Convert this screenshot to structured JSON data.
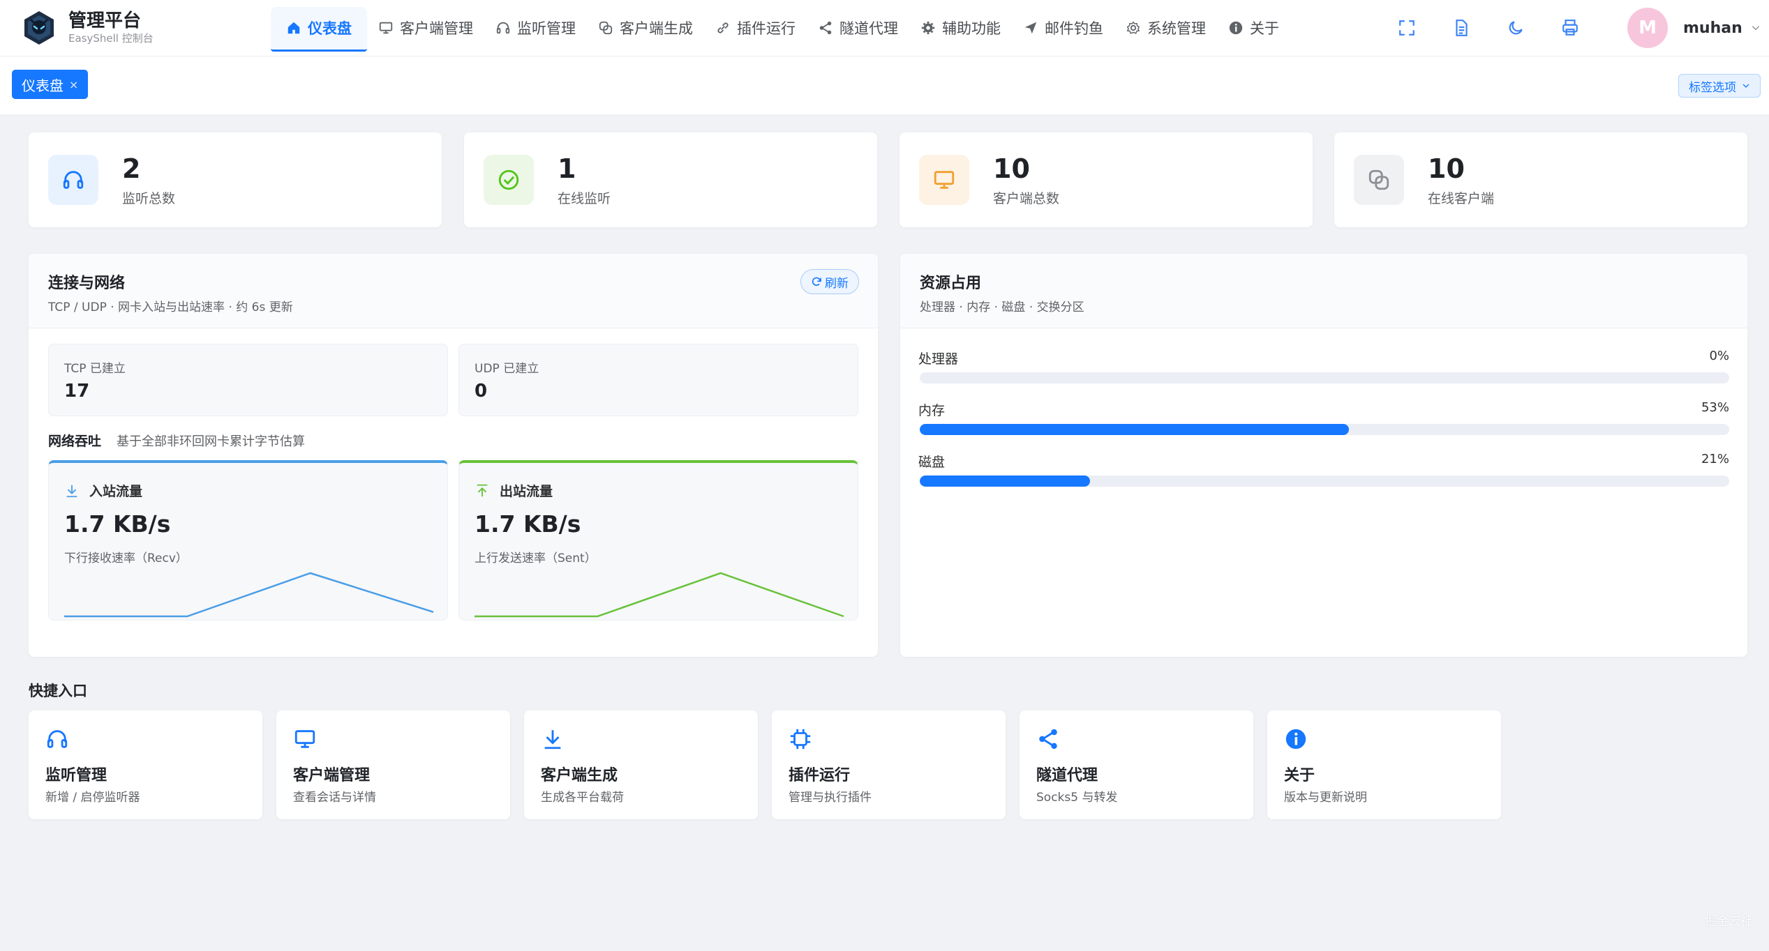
{
  "brand": {
    "title": "管理平台",
    "subtitle": "EasyShell 控制台"
  },
  "nav": [
    {
      "label": "仪表盘",
      "icon": "home-icon",
      "active": true
    },
    {
      "label": "客户端管理",
      "icon": "monitor-icon"
    },
    {
      "label": "监听管理",
      "icon": "headset-icon"
    },
    {
      "label": "客户端生成",
      "icon": "link-icon"
    },
    {
      "label": "插件运行",
      "icon": "chain-icon"
    },
    {
      "label": "隧道代理",
      "icon": "share-icon"
    },
    {
      "label": "辅助功能",
      "icon": "gear-icon"
    },
    {
      "label": "邮件钓鱼",
      "icon": "send-icon"
    },
    {
      "label": "系统管理",
      "icon": "settings-icon"
    },
    {
      "label": "关于",
      "icon": "info-icon"
    }
  ],
  "toolbar": {
    "icons": [
      "fullscreen-icon",
      "document-icon",
      "moon-icon",
      "printer-icon"
    ]
  },
  "user": {
    "initial": "M",
    "name": "muhan"
  },
  "tabs": {
    "active_label": "仪表盘",
    "close": "×",
    "options_label": "标签选项"
  },
  "stats": [
    {
      "value": "2",
      "label": "监听总数",
      "icon": "headset-icon",
      "color": "#1677ff",
      "bg": "#e8f2ff"
    },
    {
      "value": "1",
      "label": "在线监听",
      "icon": "check-circle-icon",
      "color": "#52c41a",
      "bg": "#ecf7e6"
    },
    {
      "value": "10",
      "label": "客户端总数",
      "icon": "monitor-icon",
      "color": "#f0a030",
      "bg": "#fdf2e4"
    },
    {
      "value": "10",
      "label": "在线客户端",
      "icon": "chain-icon",
      "color": "#8c8f94",
      "bg": "#f0f1f3"
    }
  ],
  "network": {
    "title": "连接与网络",
    "subtitle": "TCP / UDP · 网卡入站与出站速率 · 约 6s 更新",
    "refresh_label": "刷新",
    "tcp_label": "TCP 已建立",
    "tcp_value": "17",
    "udp_label": "UDP 已建立",
    "udp_value": "0",
    "throughput_title": "网络吞吐",
    "throughput_note": "基于全部非环回网卡累计字节估算",
    "inbound": {
      "title": "入站流量",
      "value": "1.7 KB/s",
      "desc": "下行接收速率（Recv）",
      "color": "#4a9ee6",
      "points": [
        0,
        0,
        1,
        0.1
      ]
    },
    "outbound": {
      "title": "出站流量",
      "value": "1.7 KB/s",
      "desc": "上行发送速率（Sent）",
      "color": "#67c23a",
      "points": [
        0,
        0,
        1,
        0
      ]
    }
  },
  "resources": {
    "title": "资源占用",
    "subtitle": "处理器 · 内存 · 磁盘 · 交换分区",
    "items": [
      {
        "name": "处理器",
        "percent_label": "0%",
        "value": 0
      },
      {
        "name": "内存",
        "percent_label": "53%",
        "value": 0.53
      },
      {
        "name": "磁盘",
        "percent_label": "21%",
        "value": 0.21
      }
    ]
  },
  "quick": {
    "title": "快捷入口",
    "items": [
      {
        "title": "监听管理",
        "desc": "新增 / 启停监听器",
        "icon": "headset-icon"
      },
      {
        "title": "客户端管理",
        "desc": "查看会话与详情",
        "icon": "monitor-icon"
      },
      {
        "title": "客户端生成",
        "desc": "生成各平台载荷",
        "icon": "download-icon"
      },
      {
        "title": "插件运行",
        "desc": "管理与执行插件",
        "icon": "chip-icon"
      },
      {
        "title": "隧道代理",
        "desc": "Socks5 与转发",
        "icon": "share-icon"
      },
      {
        "title": "关于",
        "desc": "版本与更新说明",
        "icon": "info-icon"
      }
    ]
  },
  "watermark": "掘金云社"
}
